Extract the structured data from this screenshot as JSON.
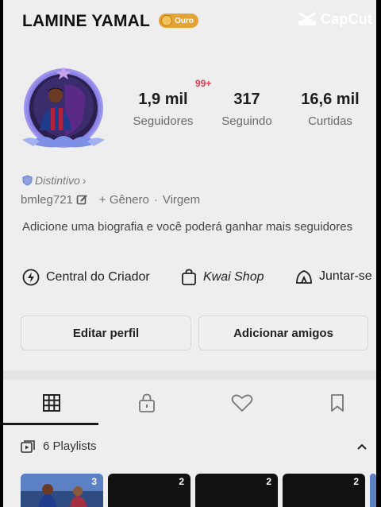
{
  "header": {
    "username": "LAMINE YAMAL",
    "badge_label": "Ouro",
    "watermark": "CapCut"
  },
  "stats": [
    {
      "value": "1,9 mil",
      "label": "Seguidores"
    },
    {
      "value": "317",
      "label": "Seguindo"
    },
    {
      "value": "16,6 mil",
      "label": "Curtidas"
    }
  ],
  "notification_badge": "99+",
  "profile": {
    "distintivo": "Distintivo",
    "handle": "bmleg721",
    "gender": "+ Gênero",
    "dot": "·",
    "sign": "Virgem",
    "bio": "Adicione uma biografia e você poderá ganhar mais seguidores"
  },
  "tools": [
    {
      "label": "Central do Criador",
      "icon": "lightning-icon"
    },
    {
      "label": "Kwai Shop",
      "icon": "shopping-bag-icon"
    },
    {
      "label": "Juntar-se",
      "icon": "tent-icon"
    }
  ],
  "buttons": {
    "edit": "Editar perfil",
    "add_friends": "Adicionar amigos"
  },
  "tabs": [
    {
      "icon": "grid-icon",
      "active": true
    },
    {
      "icon": "lock-icon",
      "active": false
    },
    {
      "icon": "heart-icon",
      "active": false
    },
    {
      "icon": "bookmark-icon",
      "active": false
    }
  ],
  "playlists": {
    "label": "6 Playlists",
    "items": [
      {
        "count": "3"
      },
      {
        "count": "2"
      },
      {
        "count": "2"
      },
      {
        "count": "2"
      }
    ]
  },
  "colors": {
    "accent_red": "#e8364a",
    "badge_gold": "#e3a434",
    "background": "#eeeeee"
  }
}
